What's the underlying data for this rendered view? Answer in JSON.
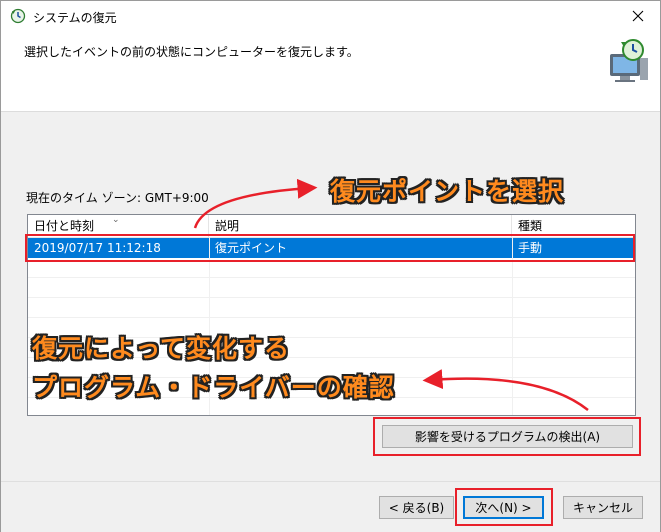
{
  "window": {
    "title": "システムの復元"
  },
  "header": {
    "instruction": "選択したイベントの前の状態にコンピューターを復元します。"
  },
  "timezone": "現在のタイム ゾーン: GMT+9:00",
  "list": {
    "columns": [
      "日付と時刻",
      "説明",
      "種類"
    ],
    "rows": [
      {
        "datetime": "2019/07/17 11:12:18",
        "description": "復元ポイント",
        "type": "手動"
      }
    ]
  },
  "buttons": {
    "scan": "影響を受けるプログラムの検出(A)",
    "back": "< 戻る(B)",
    "next": "次へ(N) >",
    "cancel": "キャンセル"
  },
  "annotations": {
    "select_point": "復元ポイントを選択",
    "line1": "復元によって変化する",
    "line2": "プログラム・ドライバーの確認"
  },
  "colors": {
    "selection": "#0078d7",
    "annotation_text": "#ff8a1e",
    "annotation_red": "#e8202a"
  },
  "icons": [
    "system-restore-icon",
    "close-icon",
    "computer-restore-icon",
    "sort-arrow-icon"
  ]
}
